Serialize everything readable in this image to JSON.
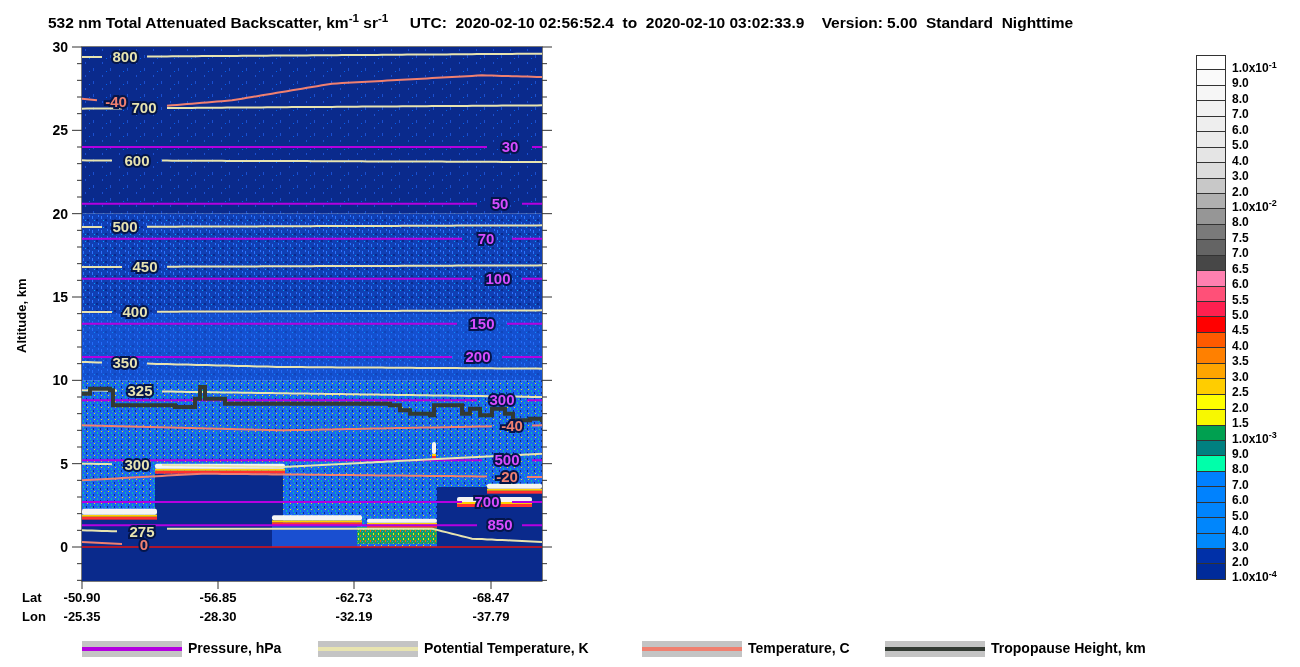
{
  "title": "532 nm Total Attenuated Backscatter, km$^{-1}$ sr$^{-1}$     UTC:  2020-02-10 02:56:52.4  to  2020-02-10 03:02:33.9    Version: 5.00  Standard  Nighttime",
  "y_axis": {
    "label": "Altitude, km",
    "ticks": [
      "30",
      "25",
      "20",
      "15",
      "10",
      "5",
      "0"
    ]
  },
  "x_axis": {
    "rows": [
      {
        "label": "Lat",
        "ticks": [
          "-50.90",
          "-56.85",
          "-62.73",
          "-68.47"
        ]
      },
      {
        "label": "Lon",
        "ticks": [
          "-25.35",
          "-28.30",
          "-32.19",
          "-37.79"
        ]
      }
    ]
  },
  "contours": {
    "pressure": [
      "30",
      "50",
      "70",
      "100",
      "150",
      "200",
      "300",
      "500",
      "700",
      "850"
    ],
    "potential_temperature": [
      "800",
      "700",
      "600",
      "500",
      "450",
      "400",
      "350",
      "325",
      "300",
      "275"
    ],
    "temperature": [
      "-40",
      "-40",
      "-20",
      "0"
    ]
  },
  "colorbar": [
    {
      "label": "1.0x10$^{-1}$",
      "color": "#ffffff"
    },
    {
      "label": "9.0",
      "color": "#fafafa"
    },
    {
      "label": "8.0",
      "color": "#f6f6f6"
    },
    {
      "label": "7.0",
      "color": "#f2f2f2"
    },
    {
      "label": "6.0",
      "color": "#eeeeee"
    },
    {
      "label": "5.0",
      "color": "#eaeaea"
    },
    {
      "label": "4.0",
      "color": "#e5e5e5"
    },
    {
      "label": "3.0",
      "color": "#dcdcdc"
    },
    {
      "label": "2.0",
      "color": "#c8c8c8"
    },
    {
      "label": "1.0x10$^{-2}$",
      "color": "#b0b0b0"
    },
    {
      "label": "8.0",
      "color": "#969696"
    },
    {
      "label": "7.5",
      "color": "#7a7a7a"
    },
    {
      "label": "7.0",
      "color": "#646464"
    },
    {
      "label": "6.5",
      "color": "#474747"
    },
    {
      "label": "6.0",
      "color": "#ff80b0"
    },
    {
      "label": "5.5",
      "color": "#ff5078"
    },
    {
      "label": "5.0",
      "color": "#ff2050"
    },
    {
      "label": "4.5",
      "color": "#ff0000"
    },
    {
      "label": "4.0",
      "color": "#ff5a00"
    },
    {
      "label": "3.5",
      "color": "#ff8000"
    },
    {
      "label": "3.0",
      "color": "#ffa500"
    },
    {
      "label": "2.5",
      "color": "#ffcd00"
    },
    {
      "label": "2.0",
      "color": "#ffff00"
    },
    {
      "label": "1.5",
      "color": "#f8f800"
    },
    {
      "label": "1.0x10$^{-3}$",
      "color": "#00a050"
    },
    {
      "label": "9.0",
      "color": "#008080"
    },
    {
      "label": "8.0",
      "color": "#00ffaa"
    },
    {
      "label": "7.0",
      "color": "#0080ff"
    },
    {
      "label": "6.0",
      "color": "#0082fe"
    },
    {
      "label": "5.0",
      "color": "#0084fd"
    },
    {
      "label": "4.0",
      "color": "#0086fc"
    },
    {
      "label": "3.0",
      "color": "#0088fb"
    },
    {
      "label": "2.0",
      "color": "#0030a8"
    },
    {
      "label": "1.0x10$^{-4}$",
      "color": "#002b9a"
    }
  ],
  "legend": [
    {
      "kind": "pressure",
      "label": "Pressure, hPa",
      "color": "#b400e0"
    },
    {
      "kind": "potential_temperature",
      "label": "Potential Temperature, K",
      "color": "#e8e4b0"
    },
    {
      "kind": "temperature",
      "label": "Temperature, C",
      "color": "#f08070"
    },
    {
      "kind": "tropopause",
      "label": "Tropopause Height, km",
      "color": "#333a33"
    }
  ]
}
